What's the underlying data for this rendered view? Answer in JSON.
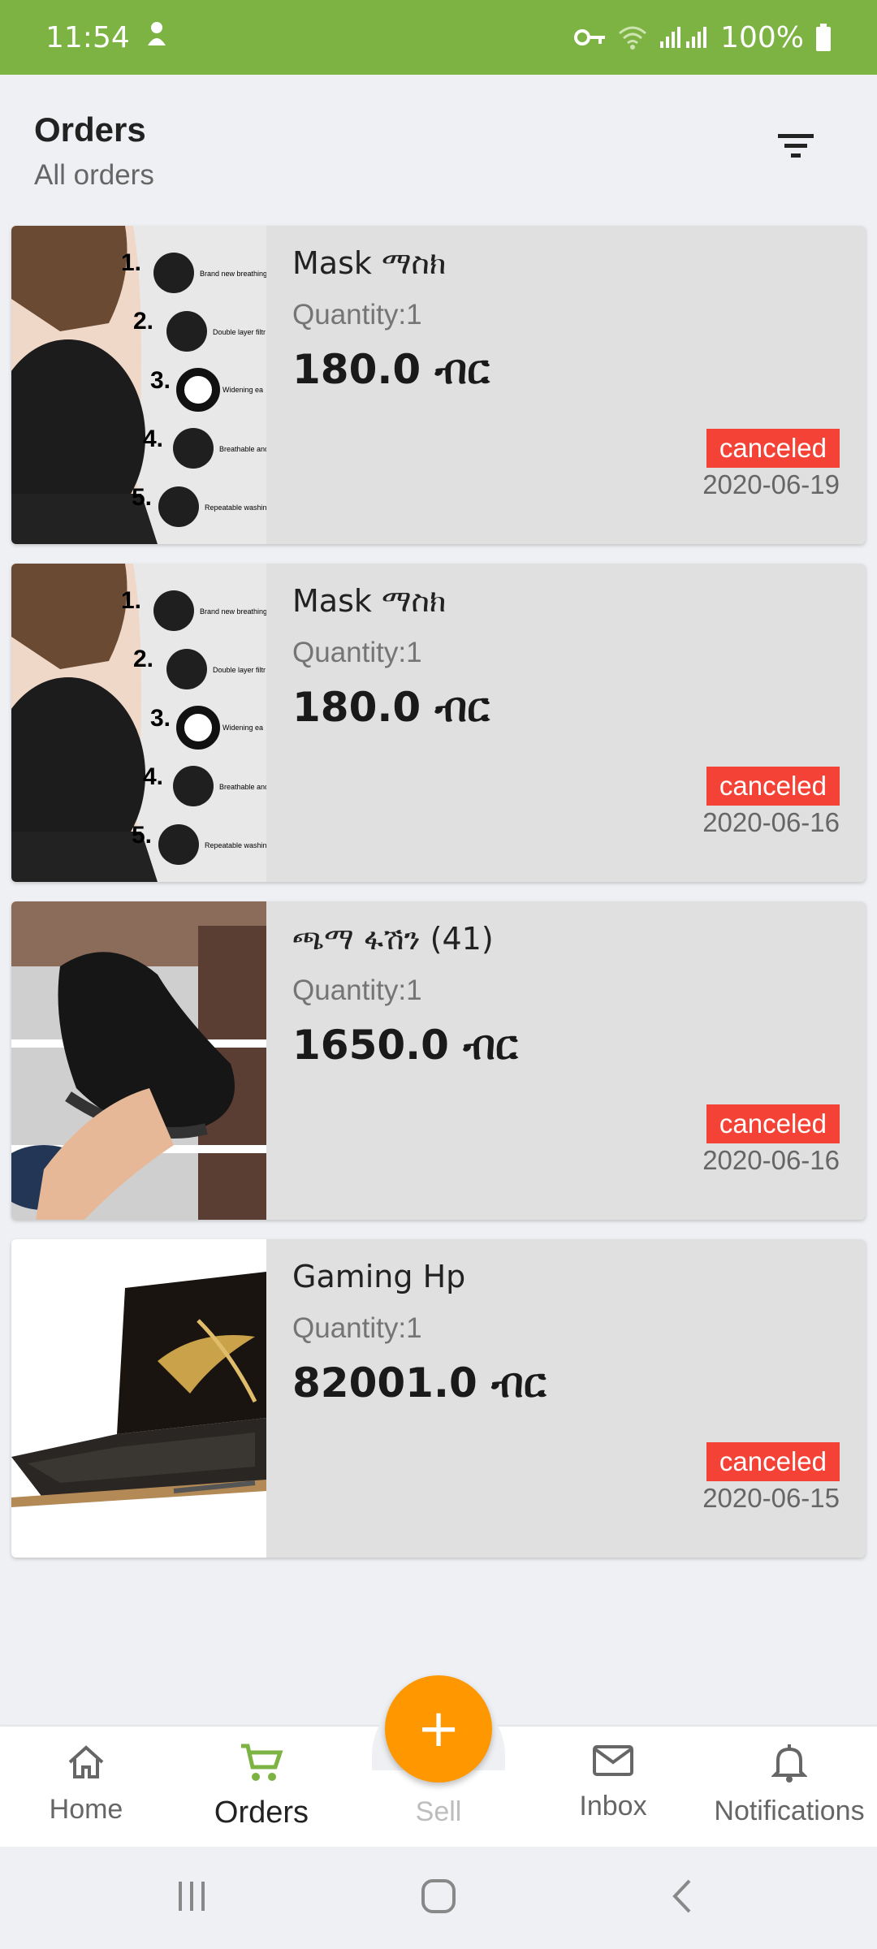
{
  "status_bar": {
    "time": "11:54",
    "battery": "100%"
  },
  "header": {
    "title": "Orders",
    "subtitle": "All orders"
  },
  "orders": [
    {
      "name": "Mask ማስክ",
      "quantity": "Quantity:1",
      "price": "180.0 ብር",
      "status": "canceled",
      "date": "2020-06-19",
      "thumb_list": [
        "1.",
        "2.",
        "3.",
        "4.",
        "5."
      ],
      "thumb_captions": [
        "Brand new breathing",
        "Double layer filtr",
        "Widening ea",
        "Breathable and c",
        "Repeatable washing"
      ]
    },
    {
      "name": "Mask ማስክ",
      "quantity": "Quantity:1",
      "price": "180.0 ብር",
      "status": "canceled",
      "date": "2020-06-16",
      "thumb_list": [
        "1.",
        "2.",
        "3.",
        "4.",
        "5."
      ],
      "thumb_captions": [
        "Brand new breathing",
        "Double layer filtr",
        "Widening ea",
        "Breathable and c",
        "Repeatable washing"
      ]
    },
    {
      "name": "ጫማ  ፋሽን (41)",
      "quantity": "Quantity:1",
      "price": "1650.0 ብር",
      "status": "canceled",
      "date": "2020-06-16"
    },
    {
      "name": "Gaming Hp",
      "quantity": "Quantity:1",
      "price": "82001.0 ብር",
      "status": "canceled",
      "date": "2020-06-15"
    }
  ],
  "nav": {
    "home": "Home",
    "orders": "Orders",
    "sell": "Sell",
    "inbox": "Inbox",
    "notifications": "Notifications",
    "fab_symbol": "+"
  },
  "colors": {
    "status_bar": "#7cb342",
    "accent": "#7cb342",
    "fab": "#ff9800",
    "canceled": "#f44336"
  },
  "icons": [
    "vpn-key-icon",
    "wifi-icon",
    "signal-icon",
    "battery-icon",
    "filter-icon",
    "home-icon",
    "cart-icon",
    "mail-icon",
    "bell-icon",
    "recents-icon",
    "home-circle-icon",
    "back-icon"
  ]
}
